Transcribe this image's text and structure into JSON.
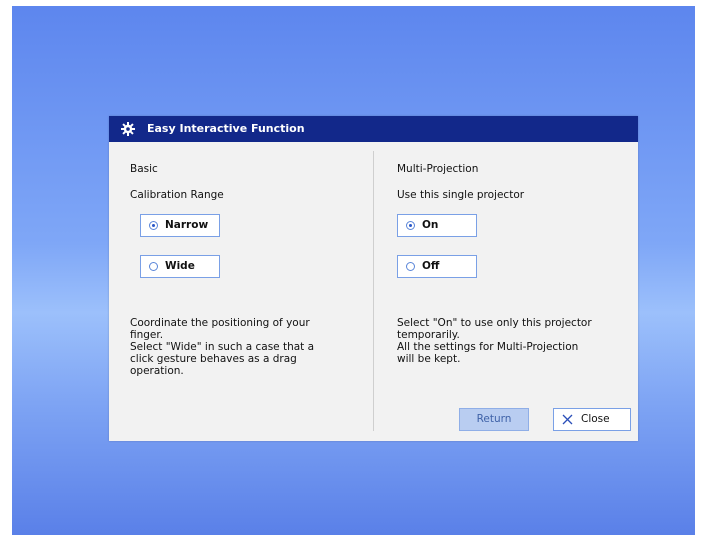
{
  "dialog": {
    "title": "Easy Interactive Function",
    "title_icon": "gear-icon"
  },
  "left": {
    "heading": "Basic",
    "subheading": "Calibration Range",
    "options": [
      {
        "label": "Narrow",
        "selected": true
      },
      {
        "label": "Wide",
        "selected": false
      }
    ],
    "description": "Coordinate the positioning of your\nfinger.\nSelect \"Wide\" in such a case that a\nclick gesture behaves as a drag\noperation."
  },
  "right": {
    "heading": "Multi-Projection",
    "subheading": "Use this single projector",
    "options": [
      {
        "label": "On",
        "selected": true
      },
      {
        "label": "Off",
        "selected": false
      }
    ],
    "description": "Select \"On\" to use only this projector\ntemporarily.\nAll the settings for Multi-Projection\nwill be kept."
  },
  "buttons": {
    "return_label": "Return",
    "close_label": "Close"
  },
  "colors": {
    "titlebar": "#12288a",
    "accent": "#2a57c9",
    "disabled_button": "#b9cdf1"
  }
}
